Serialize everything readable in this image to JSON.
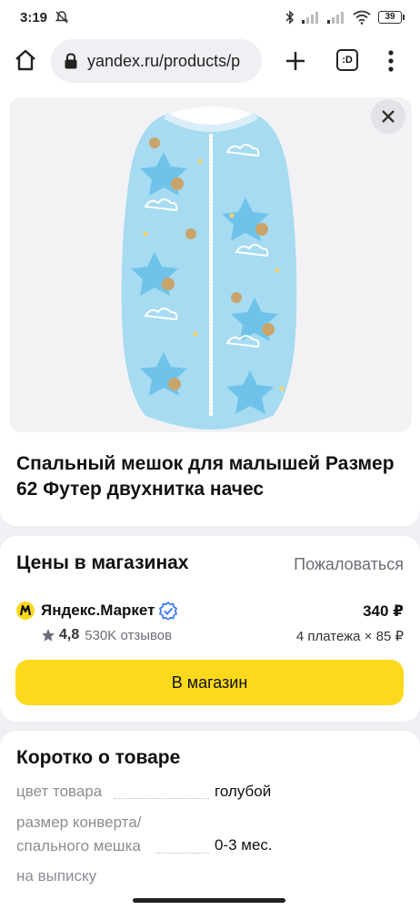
{
  "status_bar": {
    "time": "3:19",
    "battery": "39"
  },
  "browser": {
    "url": "yandex.ru/products/p",
    "tabs_label": ":D"
  },
  "product": {
    "title": "Спальный мешок для малышей Размер 62 Футер двухнитка начес",
    "image_icon": "sleeping-bag-image"
  },
  "prices": {
    "heading": "Цены в магазинах",
    "complain": "Пожаловаться",
    "shop": {
      "name": "Яндекс.Маркет",
      "rating": "4,8",
      "reviews": "530K отзывов",
      "price": "340 ₽",
      "installments": "4 платежа × 85 ₽"
    },
    "button": "В магазин"
  },
  "about": {
    "heading": "Коротко о товаре",
    "specs": [
      {
        "label": "цвет товара",
        "value": "голубой"
      },
      {
        "label": "размер конверта/ спального мешка",
        "value": "0-3 мес."
      },
      {
        "label": "на выписку",
        "value": ""
      }
    ]
  },
  "colors": {
    "button": "#fcd91c",
    "verified": "#3f7df5",
    "product": "#9fd6f0"
  }
}
